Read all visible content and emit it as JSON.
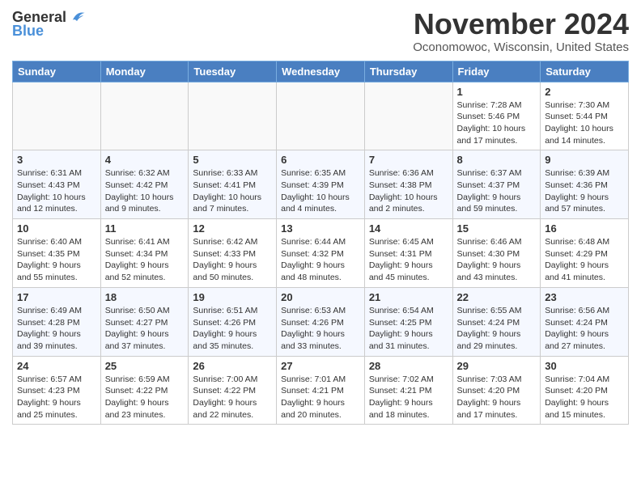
{
  "logo": {
    "general": "General",
    "blue": "Blue"
  },
  "title": "November 2024",
  "location": "Oconomowoc, Wisconsin, United States",
  "days_header": [
    "Sunday",
    "Monday",
    "Tuesday",
    "Wednesday",
    "Thursday",
    "Friday",
    "Saturday"
  ],
  "weeks": [
    [
      {
        "day": "",
        "info": ""
      },
      {
        "day": "",
        "info": ""
      },
      {
        "day": "",
        "info": ""
      },
      {
        "day": "",
        "info": ""
      },
      {
        "day": "",
        "info": ""
      },
      {
        "day": "1",
        "info": "Sunrise: 7:28 AM\nSunset: 5:46 PM\nDaylight: 10 hours and 17 minutes."
      },
      {
        "day": "2",
        "info": "Sunrise: 7:30 AM\nSunset: 5:44 PM\nDaylight: 10 hours and 14 minutes."
      }
    ],
    [
      {
        "day": "3",
        "info": "Sunrise: 6:31 AM\nSunset: 4:43 PM\nDaylight: 10 hours and 12 minutes."
      },
      {
        "day": "4",
        "info": "Sunrise: 6:32 AM\nSunset: 4:42 PM\nDaylight: 10 hours and 9 minutes."
      },
      {
        "day": "5",
        "info": "Sunrise: 6:33 AM\nSunset: 4:41 PM\nDaylight: 10 hours and 7 minutes."
      },
      {
        "day": "6",
        "info": "Sunrise: 6:35 AM\nSunset: 4:39 PM\nDaylight: 10 hours and 4 minutes."
      },
      {
        "day": "7",
        "info": "Sunrise: 6:36 AM\nSunset: 4:38 PM\nDaylight: 10 hours and 2 minutes."
      },
      {
        "day": "8",
        "info": "Sunrise: 6:37 AM\nSunset: 4:37 PM\nDaylight: 9 hours and 59 minutes."
      },
      {
        "day": "9",
        "info": "Sunrise: 6:39 AM\nSunset: 4:36 PM\nDaylight: 9 hours and 57 minutes."
      }
    ],
    [
      {
        "day": "10",
        "info": "Sunrise: 6:40 AM\nSunset: 4:35 PM\nDaylight: 9 hours and 55 minutes."
      },
      {
        "day": "11",
        "info": "Sunrise: 6:41 AM\nSunset: 4:34 PM\nDaylight: 9 hours and 52 minutes."
      },
      {
        "day": "12",
        "info": "Sunrise: 6:42 AM\nSunset: 4:33 PM\nDaylight: 9 hours and 50 minutes."
      },
      {
        "day": "13",
        "info": "Sunrise: 6:44 AM\nSunset: 4:32 PM\nDaylight: 9 hours and 48 minutes."
      },
      {
        "day": "14",
        "info": "Sunrise: 6:45 AM\nSunset: 4:31 PM\nDaylight: 9 hours and 45 minutes."
      },
      {
        "day": "15",
        "info": "Sunrise: 6:46 AM\nSunset: 4:30 PM\nDaylight: 9 hours and 43 minutes."
      },
      {
        "day": "16",
        "info": "Sunrise: 6:48 AM\nSunset: 4:29 PM\nDaylight: 9 hours and 41 minutes."
      }
    ],
    [
      {
        "day": "17",
        "info": "Sunrise: 6:49 AM\nSunset: 4:28 PM\nDaylight: 9 hours and 39 minutes."
      },
      {
        "day": "18",
        "info": "Sunrise: 6:50 AM\nSunset: 4:27 PM\nDaylight: 9 hours and 37 minutes."
      },
      {
        "day": "19",
        "info": "Sunrise: 6:51 AM\nSunset: 4:26 PM\nDaylight: 9 hours and 35 minutes."
      },
      {
        "day": "20",
        "info": "Sunrise: 6:53 AM\nSunset: 4:26 PM\nDaylight: 9 hours and 33 minutes."
      },
      {
        "day": "21",
        "info": "Sunrise: 6:54 AM\nSunset: 4:25 PM\nDaylight: 9 hours and 31 minutes."
      },
      {
        "day": "22",
        "info": "Sunrise: 6:55 AM\nSunset: 4:24 PM\nDaylight: 9 hours and 29 minutes."
      },
      {
        "day": "23",
        "info": "Sunrise: 6:56 AM\nSunset: 4:24 PM\nDaylight: 9 hours and 27 minutes."
      }
    ],
    [
      {
        "day": "24",
        "info": "Sunrise: 6:57 AM\nSunset: 4:23 PM\nDaylight: 9 hours and 25 minutes."
      },
      {
        "day": "25",
        "info": "Sunrise: 6:59 AM\nSunset: 4:22 PM\nDaylight: 9 hours and 23 minutes."
      },
      {
        "day": "26",
        "info": "Sunrise: 7:00 AM\nSunset: 4:22 PM\nDaylight: 9 hours and 22 minutes."
      },
      {
        "day": "27",
        "info": "Sunrise: 7:01 AM\nSunset: 4:21 PM\nDaylight: 9 hours and 20 minutes."
      },
      {
        "day": "28",
        "info": "Sunrise: 7:02 AM\nSunset: 4:21 PM\nDaylight: 9 hours and 18 minutes."
      },
      {
        "day": "29",
        "info": "Sunrise: 7:03 AM\nSunset: 4:20 PM\nDaylight: 9 hours and 17 minutes."
      },
      {
        "day": "30",
        "info": "Sunrise: 7:04 AM\nSunset: 4:20 PM\nDaylight: 9 hours and 15 minutes."
      }
    ]
  ]
}
